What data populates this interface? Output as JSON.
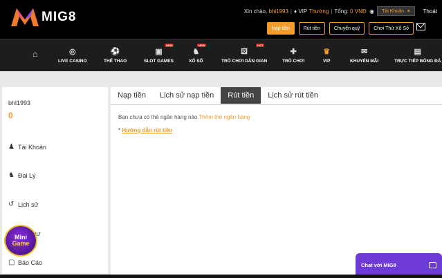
{
  "brand": {
    "name": "MIG8"
  },
  "account": {
    "greeting": "Xin chào,",
    "username": "bhl1993",
    "vip_label": "VIP",
    "vip_level": "Thường",
    "total_label": "Tổng:",
    "total_value": "0 VNĐ",
    "select_value": "Tài Khoản",
    "logout": "Thoát"
  },
  "actions": {
    "deposit": "Nạp tiền",
    "withdraw": "Rút tiền",
    "transfer": "Chuyển quỹ",
    "lottery_trial": "Chơi Thử Xổ Số"
  },
  "nav": [
    {
      "label": "LIVE CASINO",
      "icon": "chip-icon"
    },
    {
      "label": "THỂ THAO",
      "icon": "ball-icon"
    },
    {
      "label": "SLOT GAMES",
      "icon": "slot-icon",
      "badge": "NEW"
    },
    {
      "label": "XỔ SỐ",
      "icon": "lottery-icon",
      "badge": "NEW"
    },
    {
      "label": "TRÒ CHƠI DÂN GIAN",
      "icon": "dice-icon",
      "badge": "HOT"
    },
    {
      "label": "TRÒ CHƠI",
      "icon": "gamepad-icon"
    },
    {
      "label": "VIP",
      "icon": "crown-icon"
    },
    {
      "label": "KHUYẾN MÃI",
      "icon": "gift-icon"
    },
    {
      "label": "TRỰC TIẾP BÓNG ĐÁ",
      "icon": "tv-icon"
    }
  ],
  "sidebar": {
    "username": "bhl1993",
    "balance": "0",
    "items": [
      {
        "label": "Tài Khoản",
        "icon": "user-icon"
      },
      {
        "label": "Đại Lý",
        "icon": "agents-icon"
      },
      {
        "label": "Lịch sử",
        "icon": "history-icon"
      },
      {
        "label": "Hộp thư",
        "icon": "mail-icon"
      },
      {
        "label": "Báo Cáo",
        "icon": "report-icon"
      }
    ],
    "mini_game": {
      "line1": "Mini",
      "line2": "Game"
    }
  },
  "tabs": [
    {
      "label": "Nạp tiền",
      "active": false
    },
    {
      "label": "Lịch sử nạp tiền",
      "active": false
    },
    {
      "label": "Rút tiền",
      "active": true
    },
    {
      "label": "Lịch sử rút tiền",
      "active": false
    }
  ],
  "content": {
    "message": "Bạn chưa có thẻ ngân hàng nào",
    "add_bank_link": "Thêm thẻ ngân hàng",
    "guide_prefix": "*",
    "guide_link": "Hướng dẫn rút tiền"
  },
  "chat": {
    "label": "Chat với MIG8"
  },
  "colors": {
    "accent": "#f39b2b",
    "chat": "#6f3bd6",
    "active_tab": "#444444"
  }
}
